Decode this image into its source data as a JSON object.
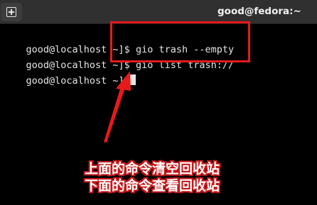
{
  "titlebar": {
    "title": "good@fedora:~",
    "new_tab_icon": "new-tab-icon"
  },
  "terminal": {
    "lines": [
      {
        "prompt": "good@localhost ~]$ ",
        "command": "gio trash --empty"
      },
      {
        "prompt": "good@localhost ~]$ ",
        "command": "gio list trash://"
      },
      {
        "prompt": "good@localhost ~]$",
        "command": ""
      }
    ]
  },
  "annotation": {
    "line1": "上面的命令清空回收站",
    "line2": "下面的命令查看回收站",
    "color": "#e6191b"
  }
}
